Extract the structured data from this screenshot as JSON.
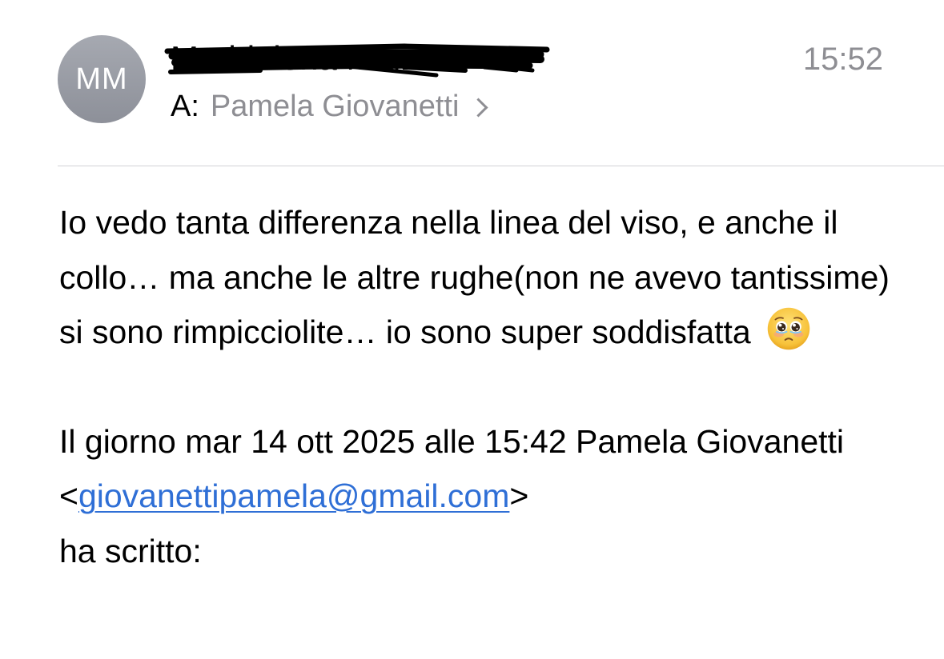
{
  "header": {
    "avatar_initials": "MM",
    "sender_name": "Maddalena Maini",
    "time": "15:52",
    "recipient_label": "A:",
    "recipient_name": "Pamela Giovanetti"
  },
  "message": {
    "paragraph": "Io vedo tanta differenza nella linea del viso, e anche il collo… ma anche le altre rughe(non ne avevo tantissime) si sono rimpicciolite… io sono super soddisfatta",
    "emoji_icon": "pleading-face-icon",
    "quote_prefix": "Il giorno mar 14 ott 2025 alle 15:42 Pamela Giovanetti <",
    "quote_email": "giovanettipamela@gmail.com",
    "quote_suffix": ">",
    "quote_wrote": "ha scritto:"
  },
  "colors": {
    "link": "#2f6fd6",
    "secondary_text": "#8e8e93",
    "avatar": "#9a9da5"
  }
}
